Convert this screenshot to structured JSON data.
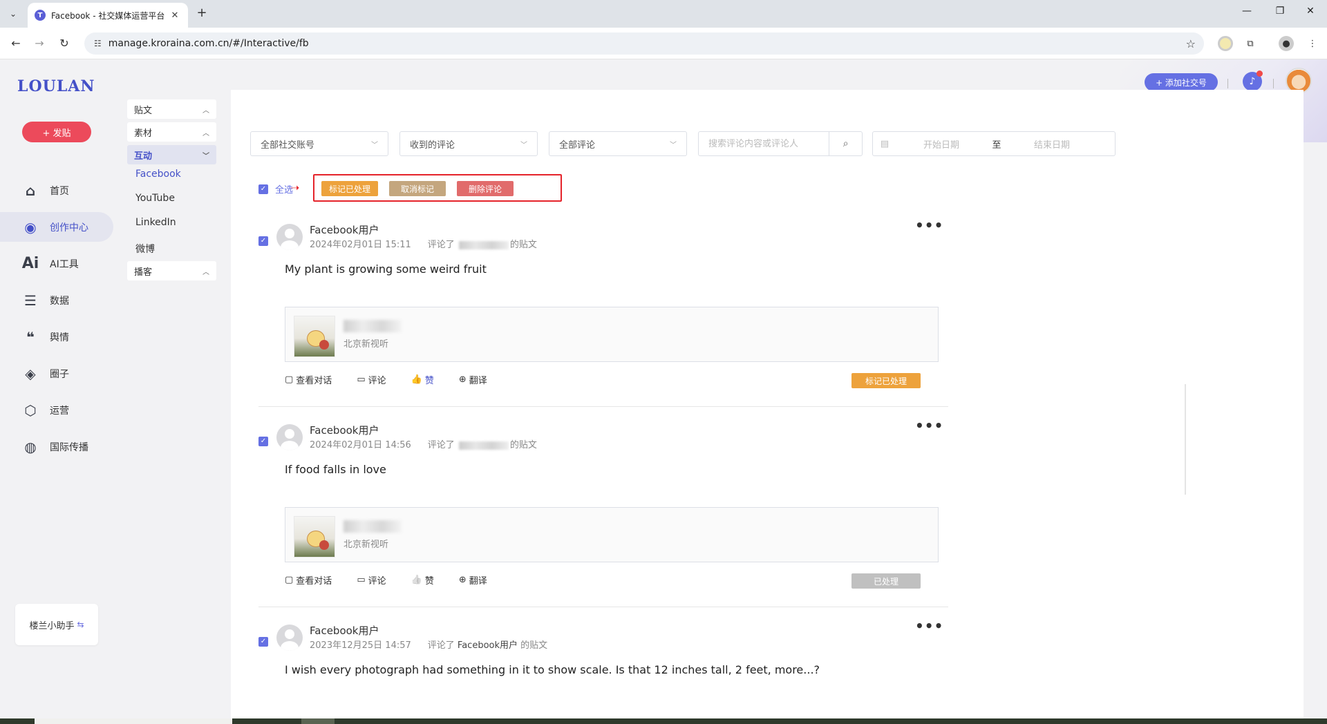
{
  "browser": {
    "tab_title": "Facebook - 社交媒体运营平台",
    "favicon_text": "T",
    "url": "manage.kroraina.com.cn/#/Interactive/fb"
  },
  "app": {
    "logo": "LOULAN",
    "post_button": "+ 发贴",
    "nav": [
      {
        "label": "首页",
        "icon": "home-icon"
      },
      {
        "label": "创作中心",
        "icon": "palette-icon"
      },
      {
        "label": "AI工具",
        "icon": "ai-icon"
      },
      {
        "label": "数据",
        "icon": "database-icon"
      },
      {
        "label": "舆情",
        "icon": "quote-icon"
      },
      {
        "label": "圈子",
        "icon": "compass-icon"
      },
      {
        "label": "运营",
        "icon": "hexagon-icon"
      },
      {
        "label": "国际传播",
        "icon": "globe-icon"
      }
    ],
    "assistant": "楼兰小助手",
    "assistant_icon": "⇆",
    "add_social_button": "+ 添加社交号"
  },
  "subnav": {
    "groups": [
      {
        "label": "贴文"
      },
      {
        "label": "素材"
      },
      {
        "label": "互动"
      }
    ],
    "links": [
      "Facebook",
      "YouTube",
      "LinkedIn",
      "微博"
    ],
    "podcast": "播客"
  },
  "filters": {
    "account": "全部社交账号",
    "received": "收到的评论",
    "all_comments": "全部评论",
    "search_placeholder": "搜索评论内容或评论人",
    "start_date": "开始日期",
    "to": "至",
    "end_date": "结束日期"
  },
  "bulk": {
    "select_all": "全选",
    "mark_processed": "标记已处理",
    "cancel_mark": "取消标记",
    "delete": "删除评论"
  },
  "comments": [
    {
      "user": "Facebook用户",
      "time": "2024年02月01日 15:11",
      "commented": "评论了",
      "post_of": "的贴文",
      "text": "My plant is growing some weird fruit",
      "source": "北京新视听",
      "status": "标记已处理"
    },
    {
      "user": "Facebook用户",
      "time": "2024年02月01日 14:56",
      "commented": "评论了",
      "post_of": "的贴文",
      "text": "If food falls in love",
      "source": "北京新视听",
      "status": "已处理"
    },
    {
      "user": "Facebook用户",
      "time": "2023年12月25日 14:57",
      "commented": "评论了",
      "target": "Facebook用户",
      "post_of": "的贴文",
      "text": "I wish every photograph had something in it to show scale. Is that 12 inches tall, 2 feet, more...?"
    }
  ],
  "actions": {
    "view_dialog": "查看对话",
    "comment": "评论",
    "like": "赞",
    "translate": "翻译"
  },
  "colors": {
    "accent": "#6570e3",
    "post_button": "#ec4a5b",
    "mark_processed": "#eda23c",
    "cancel_mark": "#c4a67e",
    "delete": "#e16b6b",
    "processed_gray": "#c0c0c0",
    "highlight_box": "#e5232a"
  }
}
